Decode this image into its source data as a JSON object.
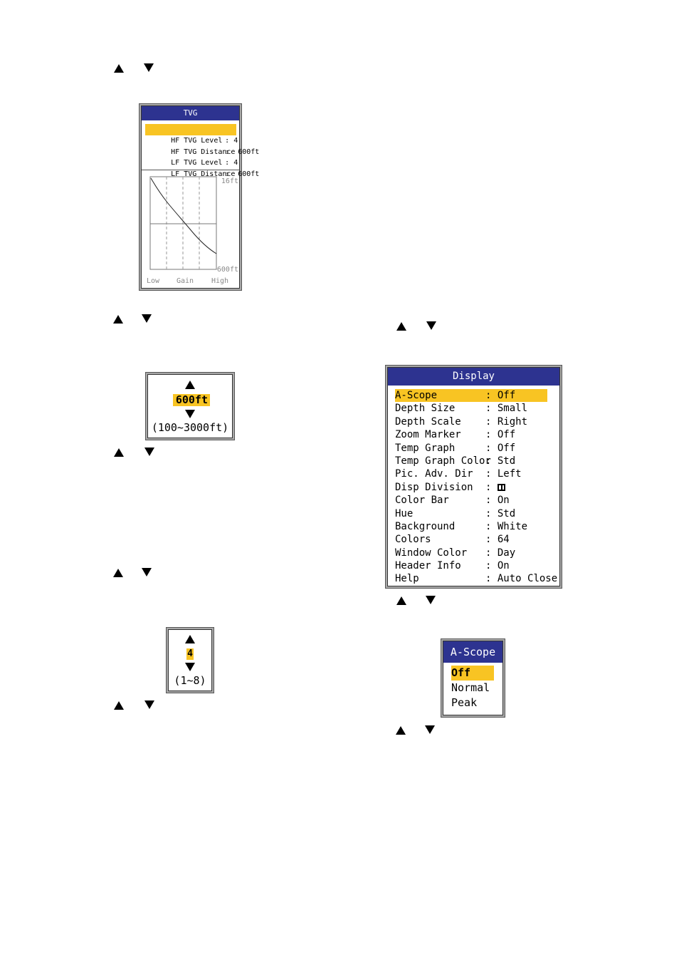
{
  "colors": {
    "title_bar": "#2d3390",
    "highlight": "#f8c423",
    "frame": "#a9a9a9"
  },
  "key_icons": {
    "up": "up-arrow-key-icon",
    "down": "down-arrow-key-icon"
  },
  "tvg_window": {
    "title": "TVG",
    "items": [
      {
        "label": "HF TVG Level",
        "sep": ":",
        "value": "4",
        "selected": true
      },
      {
        "label": "HF TVG Distance",
        "sep": ":",
        "value": "600ft",
        "selected": false
      },
      {
        "label": "LF TVG Level",
        "sep": ":",
        "value": "4",
        "selected": false
      },
      {
        "label": "LF TVG Distance",
        "sep": ":",
        "value": "600ft",
        "selected": false
      }
    ],
    "graph": {
      "top_depth_label": "16ft",
      "bottom_depth_label": "600ft",
      "x_labels": [
        "Low",
        "Gain",
        "High"
      ]
    }
  },
  "distance_popup": {
    "value": "600ft",
    "range": "(100~3000ft)"
  },
  "level_popup": {
    "value": "4",
    "range": "(1~8)"
  },
  "display_menu": {
    "title": "Display",
    "items": [
      {
        "label": "A-Scope",
        "value": "Off",
        "selected": true
      },
      {
        "label": "Depth Size",
        "value": "Small"
      },
      {
        "label": "Depth Scale",
        "value": "Right"
      },
      {
        "label": "Zoom Marker",
        "value": "Off"
      },
      {
        "label": "Temp Graph",
        "value": "Off"
      },
      {
        "label": "Temp Graph Color",
        "value": "Std"
      },
      {
        "label": "Pic. Adv. Dir",
        "value": "Left"
      },
      {
        "label": "Disp Division",
        "value": "",
        "value_icon": "split-screen-icon"
      },
      {
        "label": "Color Bar",
        "value": "On"
      },
      {
        "label": "Hue",
        "value": "Std"
      },
      {
        "label": "Background",
        "value": "White"
      },
      {
        "label": "Colors",
        "value": "64"
      },
      {
        "label": "Window Color",
        "value": "Day"
      },
      {
        "label": "Header Info",
        "value": "On"
      },
      {
        "label": "Help",
        "value": "Auto Close"
      }
    ],
    "separator": ":"
  },
  "ascope_menu": {
    "title": "A-Scope",
    "options": [
      "Off",
      "Normal",
      "Peak"
    ],
    "selected": "Off"
  }
}
